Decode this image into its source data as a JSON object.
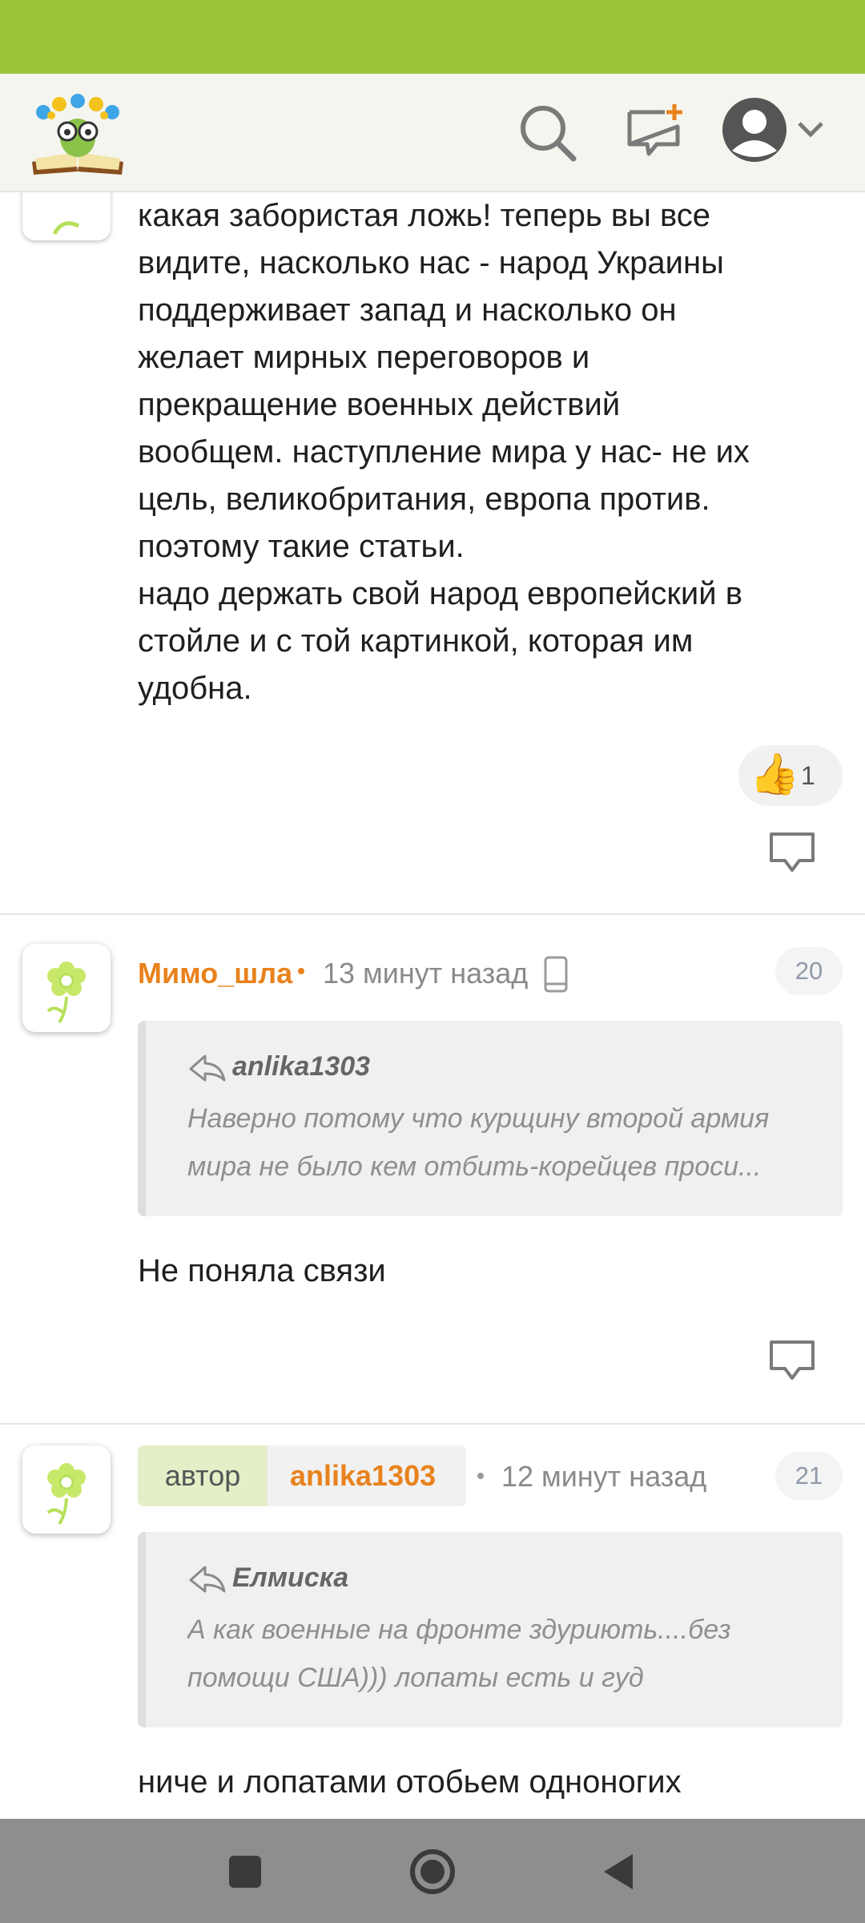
{
  "header": {
    "logo_icon": "book-owl-logo-icon",
    "search_icon": "search-icon",
    "new_post_icon": "new-message-icon",
    "profile_icon": "user-avatar-icon",
    "chevron_icon": "chevron-down-icon"
  },
  "comments": [
    {
      "body": "какая забористая ложь! теперь вы все\nвидите, насколько нас - народ Украины\nподдерживает запад и насколько он\nжелает мирных переговоров и\nпрекращение военных действий\nвообщем. наступление мира у нас- не их\nцель, великобритания, европа против.\nпоэтому такие статьи.\nнадо держать свой народ европейский в\nстойле и с той картинкой, которая им\nудобна.",
      "like_emoji": "👍",
      "likes": "1"
    },
    {
      "author": "Мимо_шла",
      "time": "13 минут назад",
      "number": "20",
      "quote_author": "anlika1303",
      "quote_lines": [
        "Наверно потому что курщину второй армия",
        "мира не было кем отбить-корейцев проси..."
      ],
      "body": "Не поняла связи"
    },
    {
      "author_tag": "автор",
      "author": "anlika1303",
      "time": "12 минут назад",
      "number": "21",
      "quote_author": "Елмиска",
      "quote_lines": [
        "А как военные на фронте здуриють....без",
        "помощи США))) лопаты есть и гуд"
      ],
      "body": "ниче и лопатами отобьем одноногих"
    }
  ],
  "colors": {
    "brand_green": "#9dc43a",
    "author_orange": "#e8821c",
    "nav_grey": "#8e8e8e"
  }
}
